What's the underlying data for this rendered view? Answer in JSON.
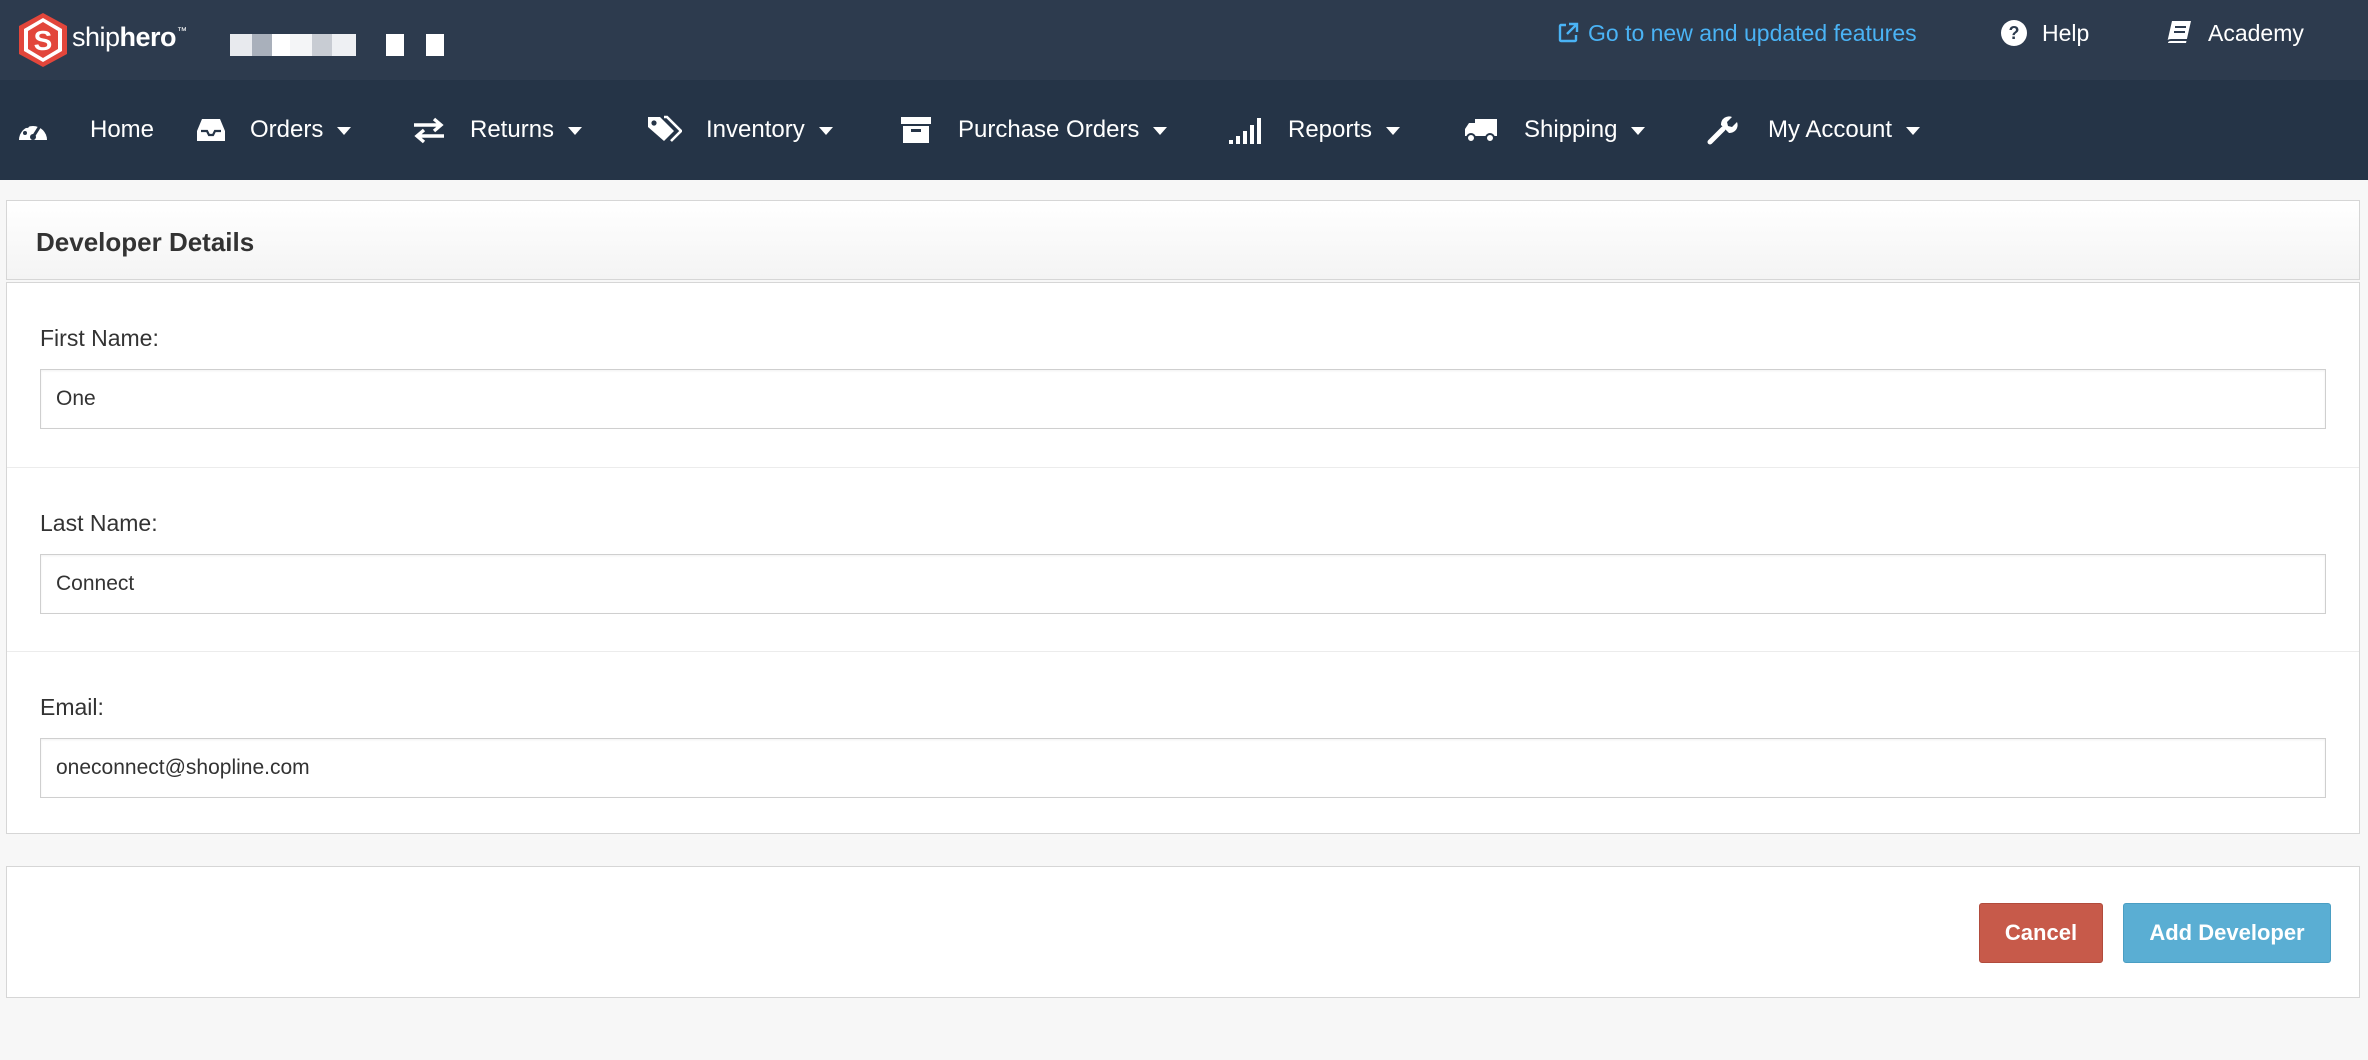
{
  "brand": {
    "logo_text_regular": "ship",
    "logo_text_bold": "hero",
    "trademark": "™",
    "logo_color": "#e2463b"
  },
  "topbar": {
    "features_link": "Go to new and updated features",
    "features_icon": "external-link-icon",
    "help": "Help",
    "help_icon": "question-circle-icon",
    "academy": "Academy",
    "academy_icon": "book-icon",
    "link_color": "#4ab3f5"
  },
  "nav": {
    "items": [
      {
        "label": "Home",
        "icon": "dashboard-gauge-icon"
      },
      {
        "label": "Orders",
        "icon": "inbox-tray-icon"
      },
      {
        "label": "Returns",
        "icon": "exchange-arrows-icon"
      },
      {
        "label": "Inventory",
        "icon": "tags-icon"
      },
      {
        "label": "Purchase Orders",
        "icon": "archive-box-icon"
      },
      {
        "label": "Reports",
        "icon": "signal-bars-icon"
      },
      {
        "label": "Shipping",
        "icon": "truck-icon"
      },
      {
        "label": "My Account",
        "icon": "wrench-icon"
      }
    ]
  },
  "panel": {
    "title": "Developer Details"
  },
  "form": {
    "first_name": {
      "label": "First Name:",
      "value": "One"
    },
    "last_name": {
      "label": "Last Name:",
      "value": "Connect"
    },
    "email": {
      "label": "Email:",
      "value": "oneconnect@shopline.com"
    }
  },
  "actions": {
    "cancel": "Cancel",
    "add": "Add Developer",
    "cancel_color": "#c75a4a",
    "add_color": "#5aaed3"
  }
}
